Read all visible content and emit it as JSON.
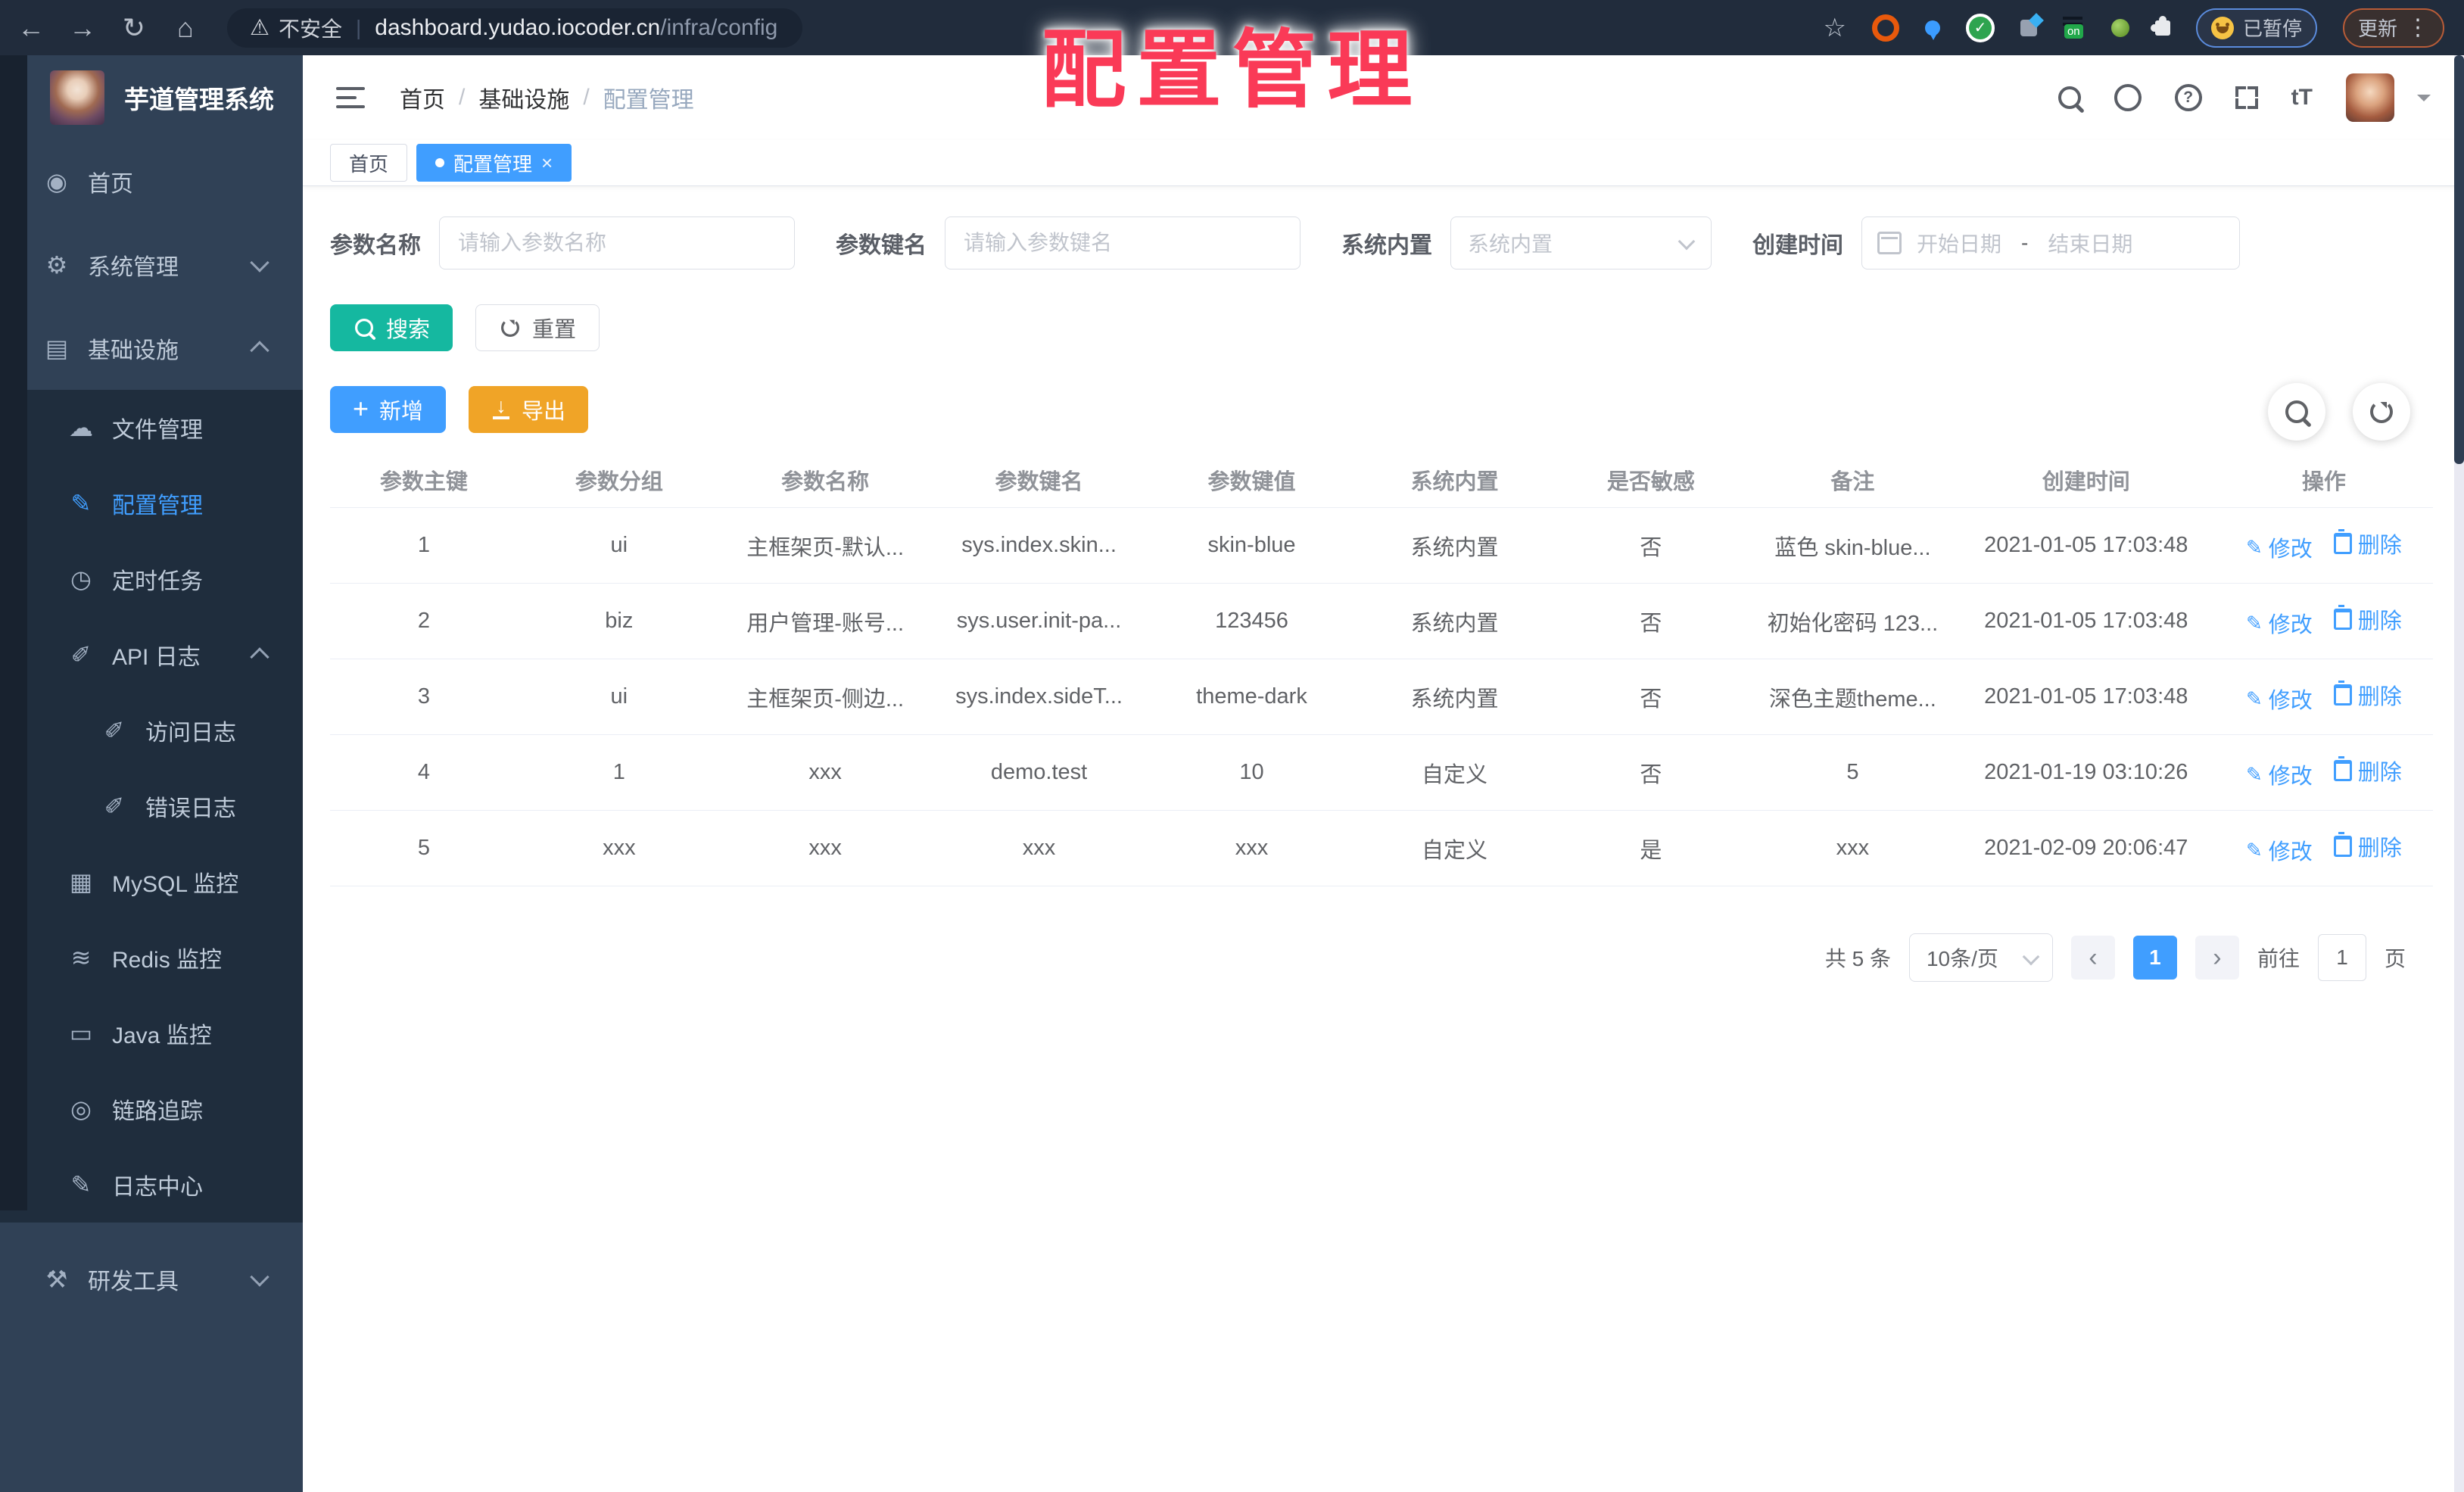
{
  "overlay_title": "配置管理",
  "colors": {
    "accent": "#409eff",
    "search_button": "#15b8a0",
    "export_button": "#f0a427",
    "overlay_red": "#fa3a57",
    "sidebar_bg": "#304156",
    "submenu_bg": "#1f2d3d"
  },
  "browser": {
    "security_label": "不安全",
    "url_host": "dashboard.yudao.iocoder.cn",
    "url_path": "/infra/config",
    "ext_on_badge": "on",
    "paused_label": "已暂停",
    "update_label": "更新"
  },
  "icon_glyphs": {
    "dashboard-icon": "◉",
    "gear-icon": "⚙",
    "infrastructure-icon": "▤",
    "cloud-upload-icon": "☁",
    "config-edit-icon": "✎",
    "schedule-icon": "◷",
    "api-log-icon": "✐",
    "access-log-icon": "✐",
    "error-log-icon": "✐",
    "mysql-monitor-icon": "▦",
    "redis-monitor-icon": "≋",
    "java-monitor-icon": "▭",
    "trace-eye-icon": "◎",
    "log-center-icon": "✎",
    "devtools-icon": "⚒"
  },
  "sidebar": {
    "app_title": "芋道管理系统",
    "items": [
      {
        "name": "home",
        "label": "首页",
        "icon": "dashboard-icon",
        "level": 0
      },
      {
        "name": "system-management",
        "label": "系统管理",
        "icon": "gear-icon",
        "level": 0,
        "chevron": "down"
      },
      {
        "name": "infrastructure",
        "label": "基础设施",
        "icon": "infrastructure-icon",
        "level": 0,
        "chevron": "up"
      },
      {
        "name": "file-management",
        "label": "文件管理",
        "icon": "cloud-upload-icon",
        "level": 1
      },
      {
        "name": "config-management",
        "label": "配置管理",
        "icon": "config-edit-icon",
        "level": 1,
        "active": true
      },
      {
        "name": "scheduled-tasks",
        "label": "定时任务",
        "icon": "schedule-icon",
        "level": 1
      },
      {
        "name": "api-logs",
        "label": "API 日志",
        "icon": "api-log-icon",
        "level": 1,
        "chevron": "up"
      },
      {
        "name": "access-logs",
        "label": "访问日志",
        "icon": "access-log-icon",
        "level": 2
      },
      {
        "name": "error-logs",
        "label": "错误日志",
        "icon": "error-log-icon",
        "level": 2
      },
      {
        "name": "mysql-monitor",
        "label": "MySQL 监控",
        "icon": "mysql-monitor-icon",
        "level": 1
      },
      {
        "name": "redis-monitor",
        "label": "Redis 监控",
        "icon": "redis-monitor-icon",
        "level": 1
      },
      {
        "name": "java-monitor",
        "label": "Java 监控",
        "icon": "java-monitor-icon",
        "level": 1
      },
      {
        "name": "link-trace",
        "label": "链路追踪",
        "icon": "trace-eye-icon",
        "level": 1
      },
      {
        "name": "log-center",
        "label": "日志中心",
        "icon": "log-center-icon",
        "level": 1
      },
      {
        "name": "devtools",
        "label": "研发工具",
        "icon": "devtools-icon",
        "level": 0,
        "chevron": "down",
        "top_gap": 20
      }
    ]
  },
  "header": {
    "breadcrumb": [
      "首页",
      "基础设施",
      "配置管理"
    ],
    "breadcrumb_separator": "/"
  },
  "tabs": [
    {
      "label": "首页",
      "active": false
    },
    {
      "label": "配置管理",
      "active": true,
      "closable": true
    }
  ],
  "filters": {
    "name_label": "参数名称",
    "name_placeholder": "请输入参数名称",
    "key_label": "参数键名",
    "key_placeholder": "请输入参数键名",
    "type_label": "系统内置",
    "type_placeholder": "系统内置",
    "date_label": "创建时间",
    "date_start_placeholder": "开始日期",
    "date_separator": "-",
    "date_end_placeholder": "结束日期"
  },
  "toolbar": {
    "search_label": "搜索",
    "reset_label": "重置",
    "add_label": "新增",
    "export_label": "导出"
  },
  "table": {
    "columns": [
      {
        "key": "id",
        "label": "参数主键"
      },
      {
        "key": "group",
        "label": "参数分组"
      },
      {
        "key": "name",
        "label": "参数名称"
      },
      {
        "key": "param-key",
        "label": "参数键名"
      },
      {
        "key": "value",
        "label": "参数键值"
      },
      {
        "key": "type",
        "label": "系统内置"
      },
      {
        "key": "sensitive",
        "label": "是否敏感"
      },
      {
        "key": "remark",
        "label": "备注"
      },
      {
        "key": "created",
        "label": "创建时间"
      },
      {
        "key": "actions",
        "label": "操作"
      }
    ],
    "rows": [
      [
        "1",
        "ui",
        "主框架页-默认...",
        "sys.index.skin...",
        "skin-blue",
        "系统内置",
        "否",
        "蓝色 skin-blue...",
        "2021-01-05 17:03:48"
      ],
      [
        "2",
        "biz",
        "用户管理-账号...",
        "sys.user.init-pa...",
        "123456",
        "系统内置",
        "否",
        "初始化密码 123...",
        "2021-01-05 17:03:48"
      ],
      [
        "3",
        "ui",
        "主框架页-侧边...",
        "sys.index.sideT...",
        "theme-dark",
        "系统内置",
        "否",
        "深色主题theme...",
        "2021-01-05 17:03:48"
      ],
      [
        "4",
        "1",
        "xxx",
        "demo.test",
        "10",
        "自定义",
        "否",
        "5",
        "2021-01-19 03:10:26"
      ],
      [
        "5",
        "xxx",
        "xxx",
        "xxx",
        "xxx",
        "自定义",
        "是",
        "xxx",
        "2021-02-09 20:06:47"
      ]
    ],
    "edit_label": "修改",
    "delete_label": "删除"
  },
  "pagination": {
    "total_label": "共 5 条",
    "page_size_value": "10条/页",
    "current_page": "1",
    "goto_label": "前往",
    "goto_value": "1",
    "page_unit": "页"
  }
}
